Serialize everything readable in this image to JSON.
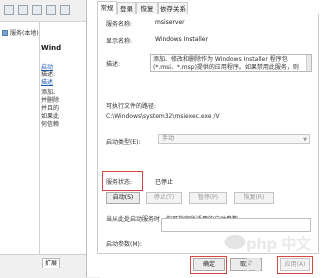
{
  "background_window": {
    "tree_item": "服务(本地)",
    "detail_title": "Wind",
    "detail_link1": "启动",
    "detail_link2": "描述",
    "detail_lines": [
      "描述:",
      "添加、",
      "并删除",
      "并且的",
      "如果此",
      "何信赖"
    ],
    "bottom_tab": "扩展"
  },
  "dialog": {
    "tabs": [
      "常规",
      "登录",
      "恢复",
      "依存关系"
    ],
    "active_tab": "常规",
    "service_name_label": "服务名称:",
    "service_name": "msiserver",
    "display_name_label": "显示名称:",
    "display_name": "Windows Installer",
    "description_label": "描述:",
    "description": "添加、修改和删除作为 Windows Installer 程序包(*.msi、*.msp)提供的应用程序。如果禁用此服务，则",
    "exe_path_label": "可执行文件的路径:",
    "exe_path": "C:\\Windows\\system32\\msiexec.exe /V",
    "startup_type_label": "启动类型(E):",
    "startup_type": "手动",
    "status_label": "服务状态:",
    "status": "已停止",
    "buttons": {
      "start": "启动(S)",
      "stop": "停止(T)",
      "pause": "暂停(P)",
      "resume": "恢复(R)"
    },
    "hint": "当从此处启动服务时，你可指定所适用的启动参数。",
    "start_params_label": "启动参数(M):",
    "ok": "确定",
    "cancel": "取消",
    "apply": "应用(A)"
  },
  "watermark": "php 中文网",
  "colors": {
    "highlight": "#d9463f",
    "link": "#1a5bb8",
    "disabled_text": "#9a9a9a"
  }
}
